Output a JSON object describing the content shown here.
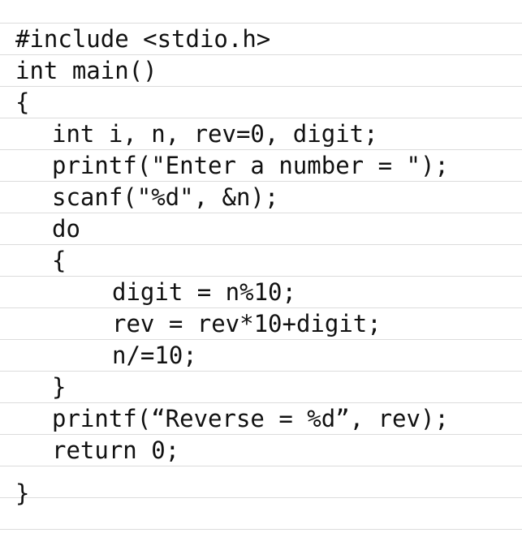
{
  "document": {
    "lines": [
      {
        "text": "#include <stdio.h>",
        "indent": 0
      },
      {
        "text": "int main()",
        "indent": 0
      },
      {
        "text": "{",
        "indent": 0
      },
      {
        "text": "int i, n, rev=0, digit;",
        "indent": 1
      },
      {
        "text": "printf(\"Enter a number = \");",
        "indent": 1
      },
      {
        "text": "scanf(\"%d\", &n);",
        "indent": 1
      },
      {
        "text": "do",
        "indent": 1
      },
      {
        "text": "{",
        "indent": 1
      },
      {
        "text": "digit = n%10;",
        "indent": 2
      },
      {
        "text": "rev = rev*10+digit;",
        "indent": 2
      },
      {
        "text": "n/=10;",
        "indent": 2
      },
      {
        "text": "}",
        "indent": 1
      },
      {
        "text": "printf(“Reverse = %d”, rev);",
        "indent": 1
      },
      {
        "text": "return 0;",
        "indent": 1
      },
      {
        "text": "}",
        "indent": 0
      }
    ]
  },
  "colors": {
    "text": "#111111",
    "rule": "#dcdcdc",
    "background": "#ffffff"
  }
}
